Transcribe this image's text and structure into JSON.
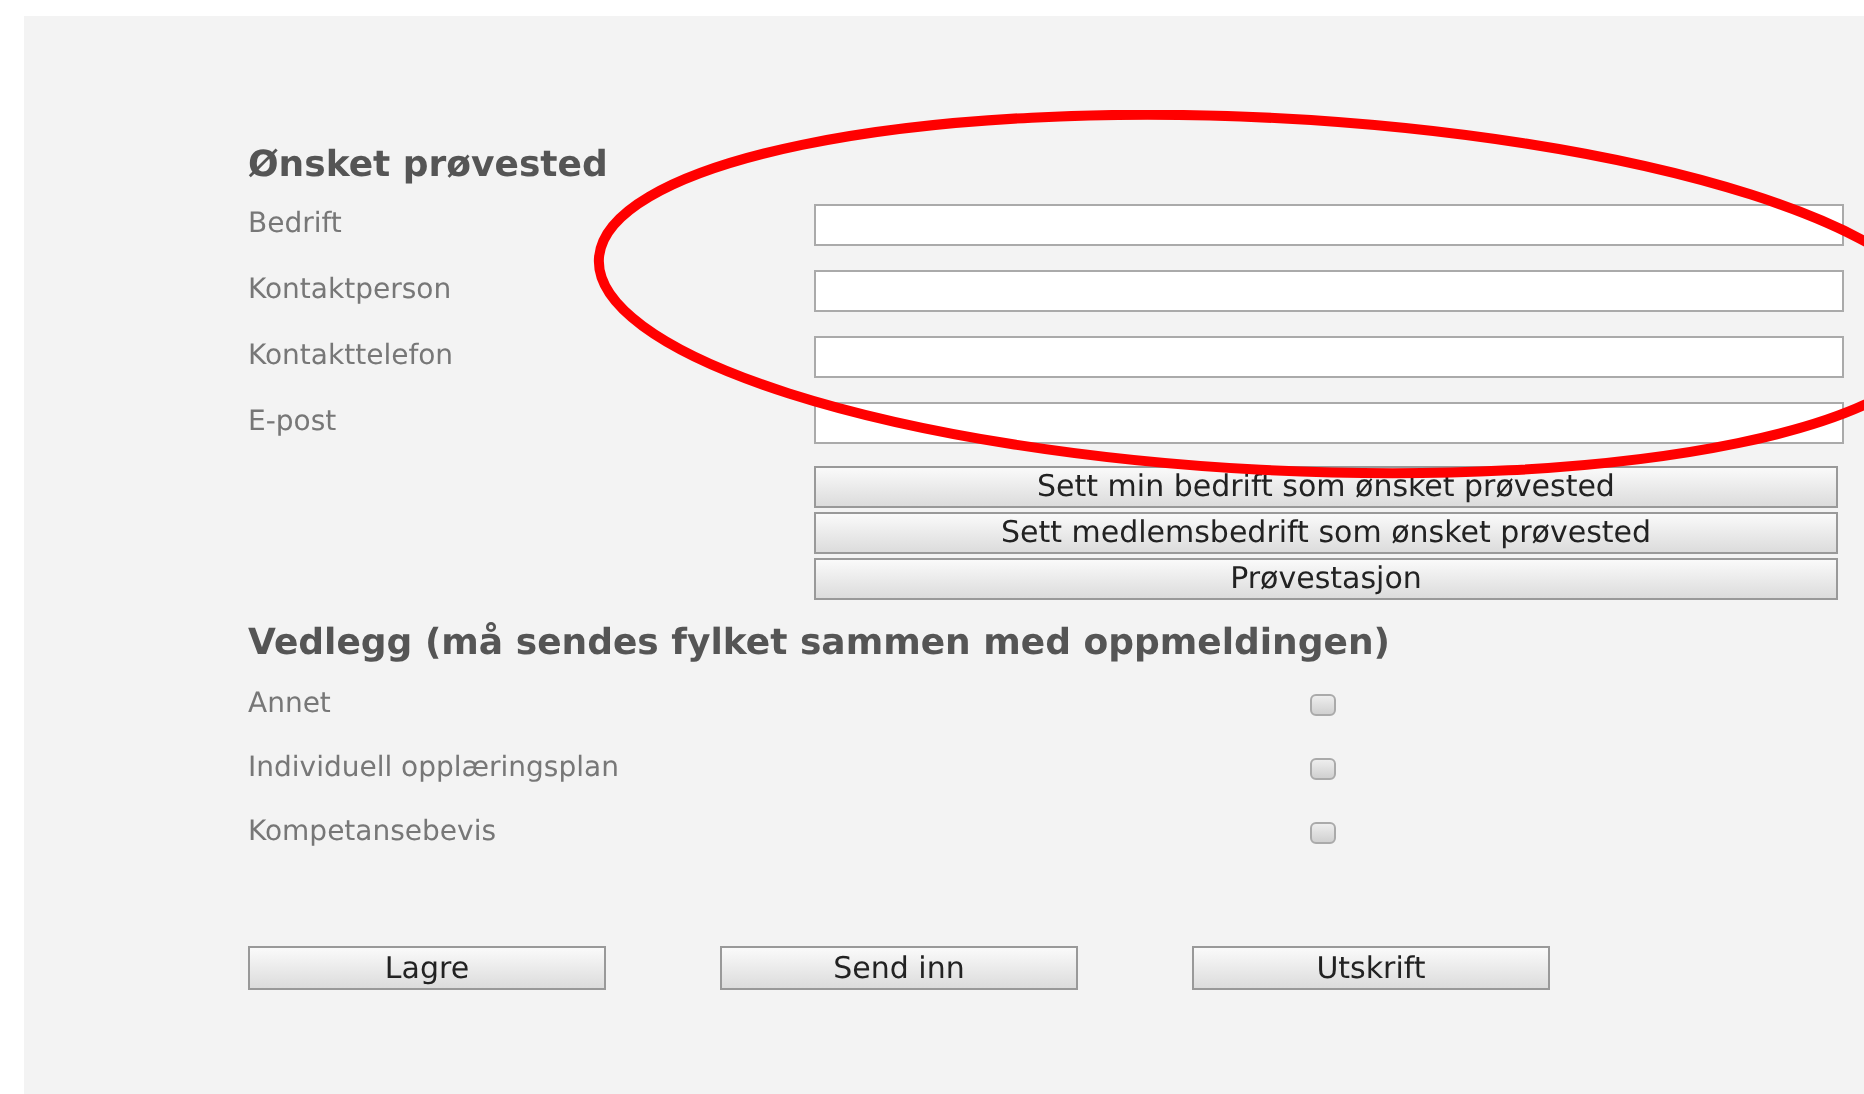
{
  "section_title": "Ønsket prøvested",
  "fields": [
    {
      "label": "Bedrift"
    },
    {
      "label": "Kontaktperson"
    },
    {
      "label": "Kontakttelefon"
    },
    {
      "label": "E-post"
    }
  ],
  "site_buttons": [
    "Sett min bedrift som ønsket prøvested",
    "Sett medlemsbedrift som ønsket prøvested",
    "Prøvestasjon"
  ],
  "attachments_title": "Vedlegg (må sendes fylket sammen med oppmeldingen)",
  "attachments": [
    {
      "label": "Annet",
      "checked": false
    },
    {
      "label": "Individuell opplæringsplan",
      "checked": false
    },
    {
      "label": "Kompetansebevis",
      "checked": false
    }
  ],
  "actions": [
    "Lagre",
    "Send inn",
    "Utskrift"
  ]
}
